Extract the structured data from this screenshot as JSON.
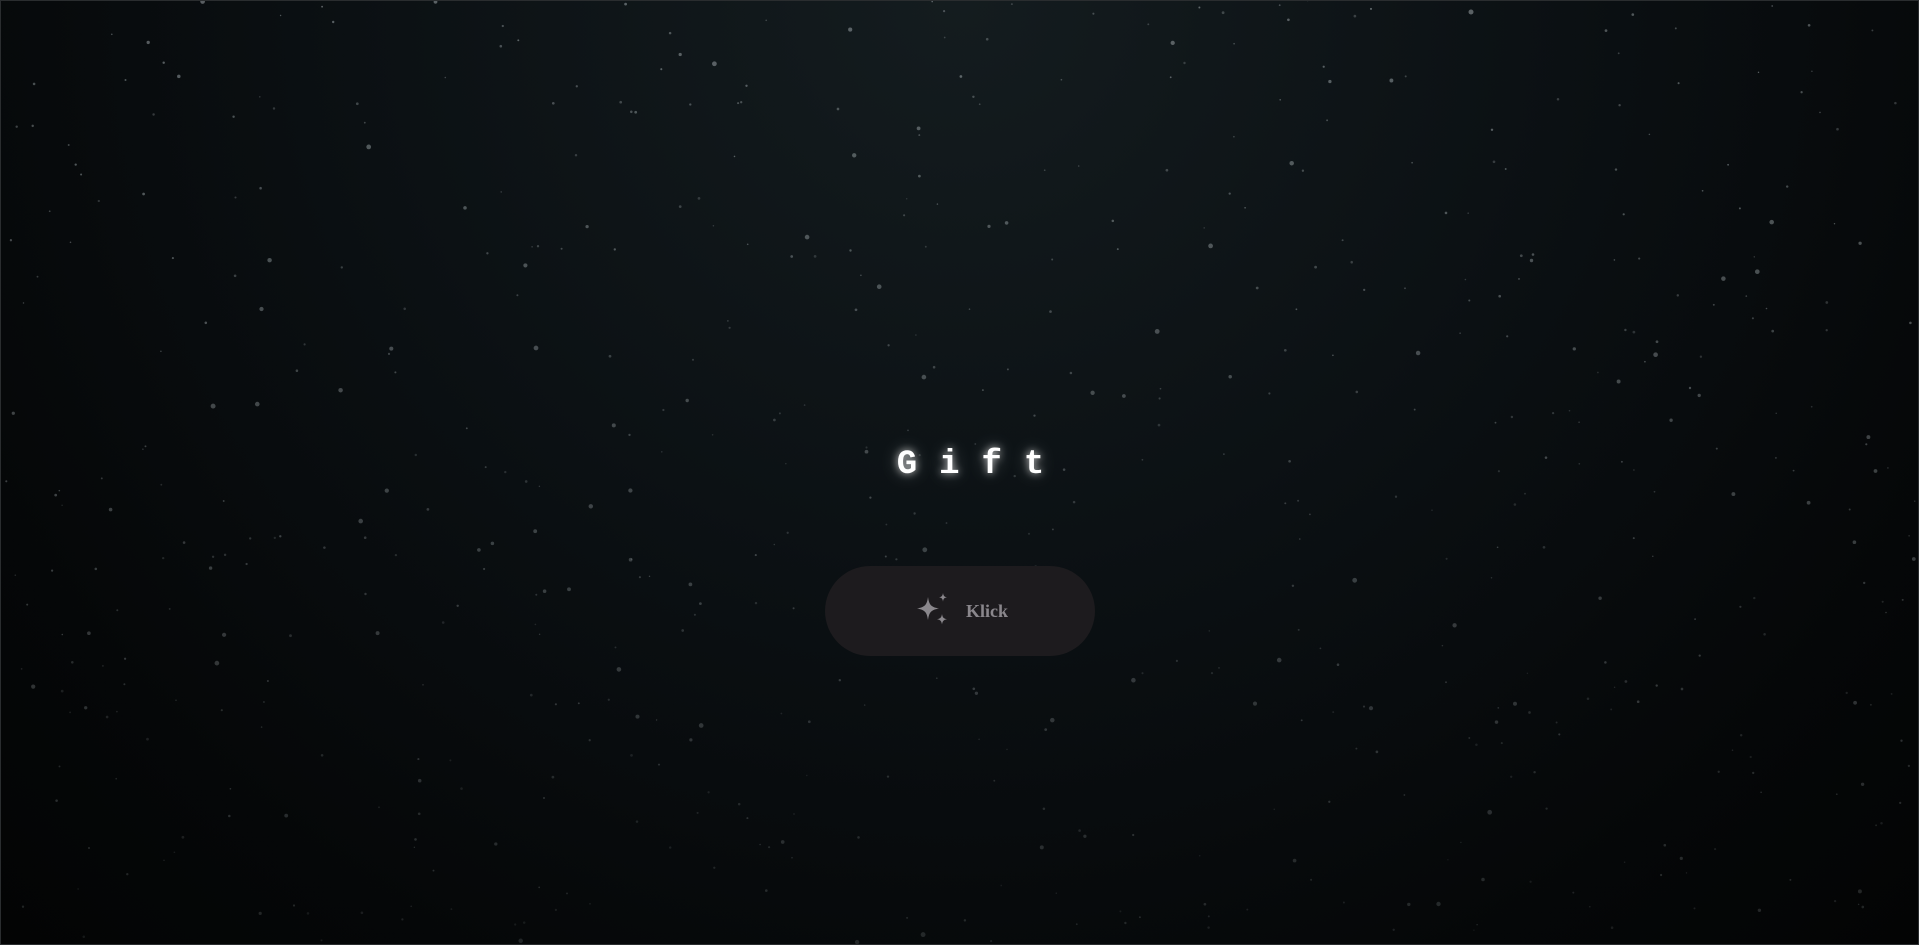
{
  "page": {
    "title": "Gift"
  },
  "button": {
    "label": "Klick",
    "icon": "sparkles-icon"
  },
  "colors": {
    "background": "#0b1013",
    "button_bg": "#1d1b1e",
    "button_text": "#8a878c",
    "title_text": "#ffffff",
    "star": "#9aa3a6"
  }
}
